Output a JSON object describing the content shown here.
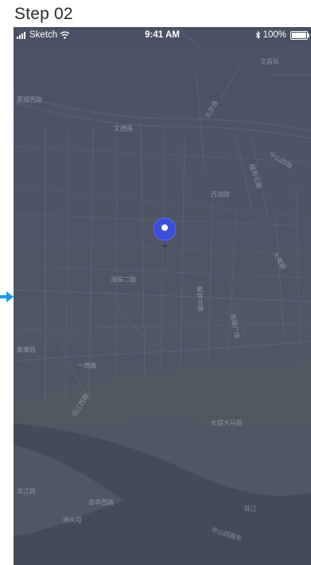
{
  "step_title": "Step 02",
  "status_bar": {
    "carrier": "Sketch",
    "time": "9:41 AM",
    "battery_percent": "100%"
  },
  "map": {
    "labels": [
      {
        "text": "文昌街"
      },
      {
        "text": "北京路"
      },
      {
        "text": "惠福西路"
      },
      {
        "text": "文德路"
      },
      {
        "text": "中山四路"
      },
      {
        "text": "越秀北路"
      },
      {
        "text": "海珠二路"
      },
      {
        "text": "解放中路"
      },
      {
        "text": "西湖路"
      },
      {
        "text": "大南路"
      },
      {
        "text": "一德路"
      },
      {
        "text": "泰康路"
      },
      {
        "text": "沿江西路"
      },
      {
        "text": "长堤大马路"
      },
      {
        "text": "海珠广场"
      },
      {
        "text": "滨江路"
      },
      {
        "text": "南华西路"
      },
      {
        "text": "中山四路东"
      },
      {
        "text": "珠江"
      },
      {
        "text": "洲头咀"
      }
    ]
  },
  "colors": {
    "map_background": "#4b5263",
    "pin": "#3b4fd8",
    "arrow": "#1a9be8"
  }
}
